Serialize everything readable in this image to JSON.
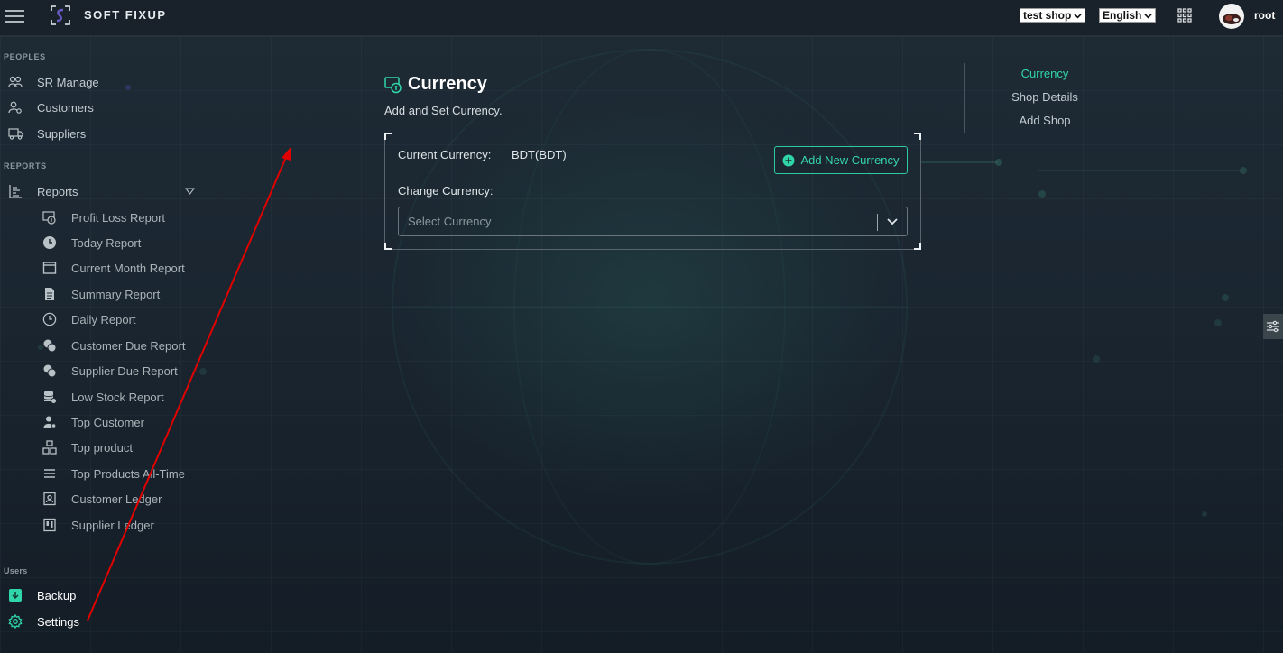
{
  "app": {
    "brand": "SOFT FIXUP",
    "shop_select": "test shop",
    "language_select": "English",
    "username": "root"
  },
  "sidebar": {
    "sections": {
      "peoples": "PEOPLES",
      "reports": "REPORTS",
      "users": "Users"
    },
    "people_items": [
      {
        "label": "SR Manage",
        "icon": "users-icon"
      },
      {
        "label": "Customers",
        "icon": "user-settings-icon"
      },
      {
        "label": "Suppliers",
        "icon": "truck-icon"
      }
    ],
    "reports_label": "Reports",
    "report_items": [
      {
        "label": "Profit Loss Report",
        "icon": "money-icon"
      },
      {
        "label": "Today Report",
        "icon": "clock-icon"
      },
      {
        "label": "Current Month Report",
        "icon": "calendar-icon"
      },
      {
        "label": "Summary Report",
        "icon": "document-icon"
      },
      {
        "label": "Daily Report",
        "icon": "clock-outline-icon"
      },
      {
        "label": "Customer Due Report",
        "icon": "coins-icon"
      },
      {
        "label": "Supplier Due Report",
        "icon": "coins-icon"
      },
      {
        "label": "Low Stock Report",
        "icon": "database-icon"
      },
      {
        "label": "Top Customer",
        "icon": "user-icon"
      },
      {
        "label": "Top product",
        "icon": "boxes-icon"
      },
      {
        "label": "Top Products All-Time",
        "icon": "list-icon"
      },
      {
        "label": "Customer Ledger",
        "icon": "contact-icon"
      },
      {
        "label": "Supplier Ledger",
        "icon": "ledger-icon"
      }
    ],
    "user_items": [
      {
        "label": "Backup",
        "icon": "backup-icon"
      },
      {
        "label": "Settings",
        "icon": "gear-icon"
      }
    ]
  },
  "main": {
    "title": "Currency",
    "subtitle": "Add and Set Currency.",
    "current_currency_label": "Current Currency:",
    "current_currency_value": "BDT(BDT)",
    "change_currency_label": "Change Currency:",
    "add_button": "Add New Currency",
    "select_placeholder": "Select Currency"
  },
  "right_nav": {
    "items": [
      {
        "label": "Currency",
        "active": true
      },
      {
        "label": "Shop Details",
        "active": false
      },
      {
        "label": "Add Shop",
        "active": false
      }
    ]
  },
  "colors": {
    "accent": "#30d5a9",
    "background": "#1a2530",
    "annotation_arrow": "#e00000"
  }
}
